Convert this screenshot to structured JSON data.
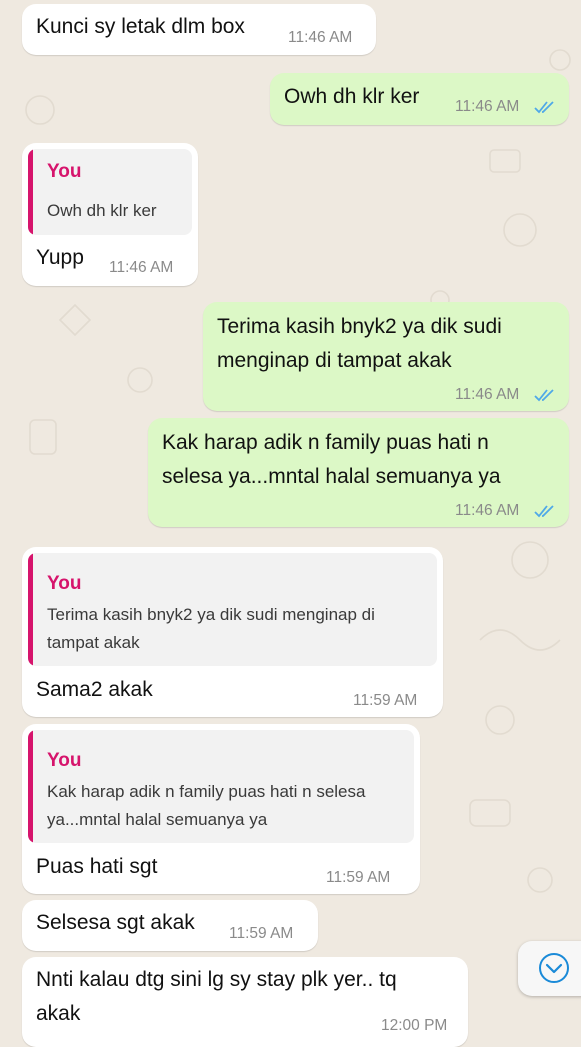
{
  "chat": {
    "messages": [
      {
        "text": "Kunci sy letak dlm box",
        "time": "11:46 AM"
      },
      {
        "text": "Owh dh klr ker",
        "time": "11:46 AM"
      },
      {
        "quote_author": "You",
        "quote_text": "Owh dh klr ker",
        "text": "Yupp",
        "time": "11:46 AM"
      },
      {
        "line1": "Terima kasih bnyk2 ya dik sudi",
        "line2": "menginap di tampat akak",
        "time": "11:46 AM"
      },
      {
        "line1": "Kak harap adik n family puas hati n",
        "line2": "selesa ya...mntal halal semuanya ya",
        "time": "11:46 AM"
      },
      {
        "quote_author": "You",
        "quote_line1": "Terima kasih bnyk2 ya dik sudi menginap di",
        "quote_line2": "tampat akak",
        "text": "Sama2 akak",
        "time": "11:59 AM"
      },
      {
        "quote_author": "You",
        "quote_line1": "Kak harap adik n family puas hati n selesa",
        "quote_line2": "ya...mntal halal semuanya ya",
        "text": "Puas hati sgt",
        "time": "11:59 AM"
      },
      {
        "text": "Selsesa sgt akak",
        "time": "11:59 AM"
      },
      {
        "line1": "Nnti kalau dtg sini lg sy stay plk yer.. tq",
        "line2": "akak",
        "time": "12:00 PM"
      }
    ]
  },
  "colors": {
    "incoming_bubble": "#ffffff",
    "outgoing_bubble": "#dcf8c6",
    "quote_accent": "#d6146c",
    "read_ticks": "#4fa8e8",
    "wallpaper": "#efe9e0"
  },
  "icons": {
    "read_receipt": "double-check-icon",
    "scroll_down": "chevron-down-circle-icon"
  }
}
